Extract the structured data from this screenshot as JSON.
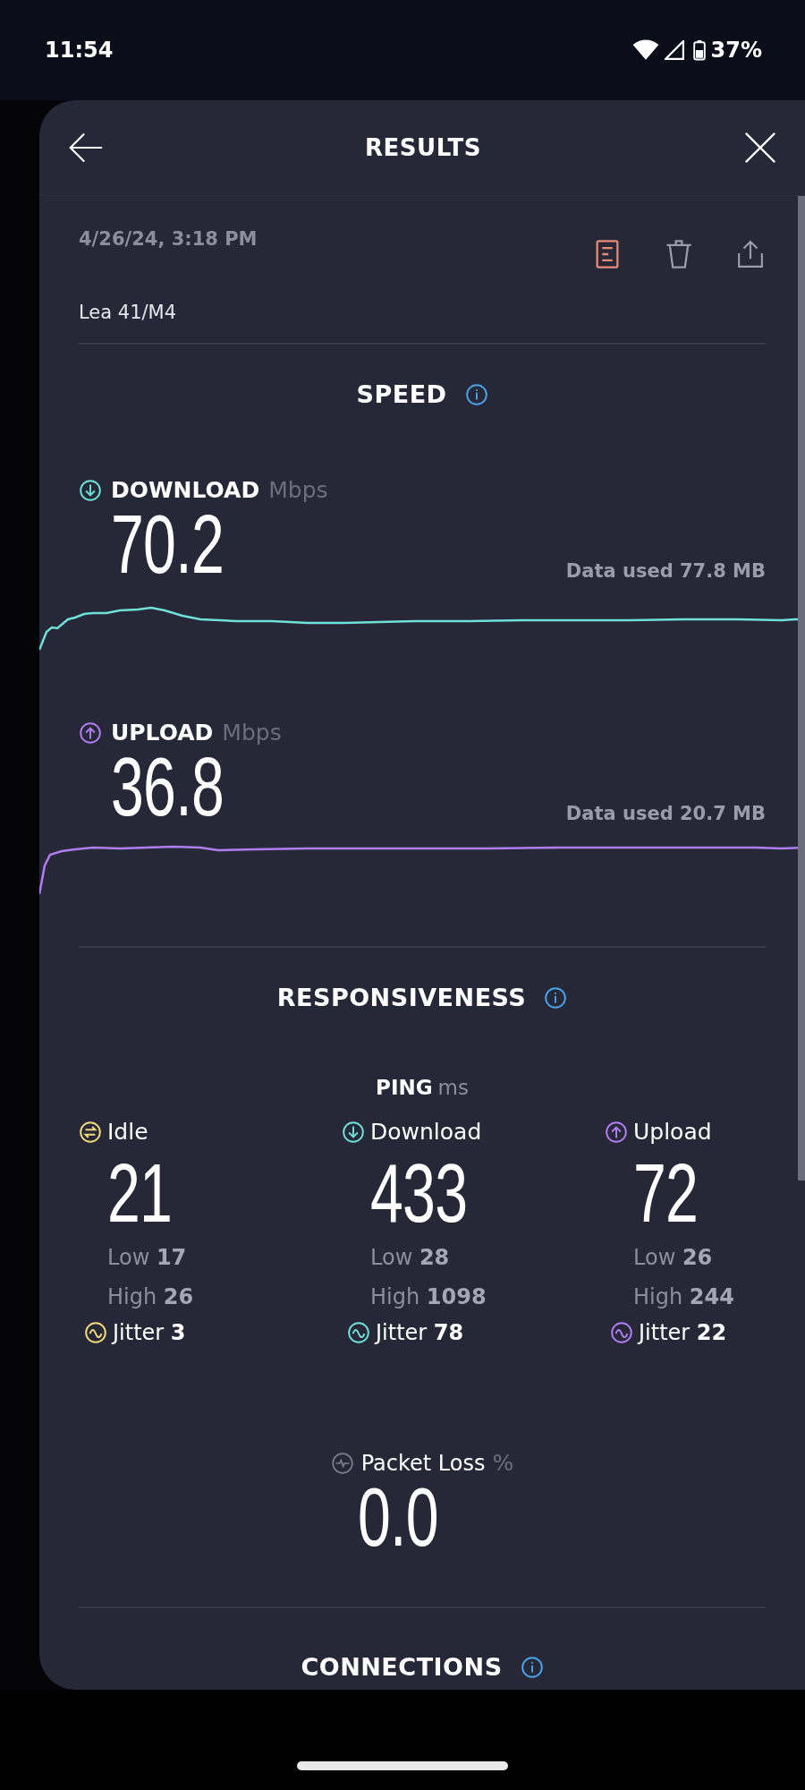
{
  "status_bar": {
    "time": "11:54",
    "battery": "37%"
  },
  "header": {
    "title": "RESULTS"
  },
  "test": {
    "date": "4/26/24, 3:18 PM",
    "server": "Lea 41/M4"
  },
  "speed": {
    "title": "SPEED",
    "metrics": [
      {
        "kind": "download",
        "label": "DOWNLOAD",
        "unit": "Mbps",
        "value": "70.2",
        "data_used": "Data used 77.8 MB",
        "color": "#6fe0d8"
      },
      {
        "kind": "upload",
        "label": "UPLOAD",
        "unit": "Mbps",
        "value": "36.8",
        "data_used": "Data used 20.7 MB",
        "color": "#b07cf0"
      }
    ]
  },
  "responsiveness": {
    "title": "RESPONSIVENESS",
    "ping_label": "PING",
    "ping_unit": "ms",
    "columns": [
      {
        "kind": "idle",
        "label": "Idle",
        "value": "21",
        "low_label": "Low",
        "low": "17",
        "high_label": "High",
        "high": "26",
        "jitter_label": "Jitter",
        "jitter": "3",
        "color": "#f0da7a"
      },
      {
        "kind": "download",
        "label": "Download",
        "value": "433",
        "low_label": "Low",
        "low": "28",
        "high_label": "High",
        "high": "1098",
        "jitter_label": "Jitter",
        "jitter": "78",
        "color": "#6fe0d8"
      },
      {
        "kind": "upload",
        "label": "Upload",
        "value": "72",
        "low_label": "Low",
        "low": "26",
        "high_label": "High",
        "high": "244",
        "jitter_label": "Jitter",
        "jitter": "22",
        "color": "#b07cf0"
      }
    ],
    "packet_loss": {
      "label": "Packet Loss",
      "unit": "%",
      "value": "0.0"
    }
  },
  "connections": {
    "title": "CONNECTIONS"
  }
}
